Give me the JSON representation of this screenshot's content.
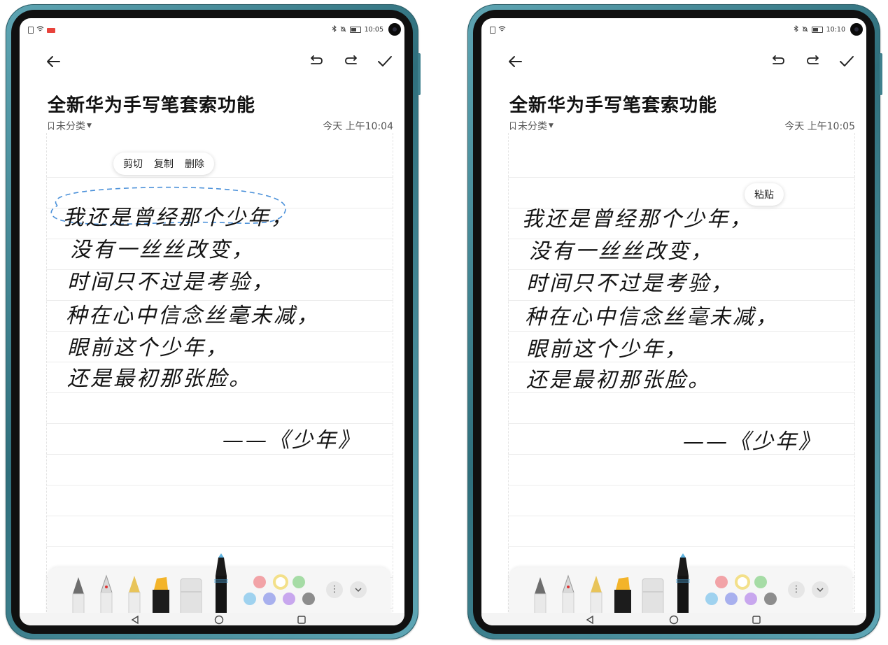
{
  "screens": [
    {
      "status": {
        "time": "10:05"
      },
      "note": {
        "title": "全新华为手写笔套索功能",
        "category": "未分类",
        "timestamp": "今天 上午10:04"
      },
      "popup": {
        "items": [
          "剪切",
          "复制",
          "删除"
        ]
      },
      "handwriting": {
        "lines": [
          "我还是曾经那个少年，",
          "没有一丝丝改变，",
          "时间只不过是考验，",
          "种在心中信念丝毫未减，",
          "眼前这个少年，",
          "还是最初那张脸。"
        ],
        "signature": "——《少年》"
      }
    },
    {
      "status": {
        "time": "10:10"
      },
      "note": {
        "title": "全新华为手写笔套索功能",
        "category": "未分类",
        "timestamp": "今天 上午10:05"
      },
      "popup": {
        "items": [
          "粘贴"
        ]
      },
      "handwriting": {
        "lines": [
          "我还是曾经那个少年，",
          "没有一丝丝改变，",
          "时间只不过是考验，",
          "种在心中信念丝毫未减，",
          "眼前这个少年，",
          "还是最初那张脸。"
        ],
        "signature": "——《少年》"
      }
    }
  ],
  "icons": {
    "back": "arrow-left-icon",
    "undo": "undo-icon",
    "redo": "redo-icon",
    "done": "check-icon",
    "more": "more-vertical-icon",
    "collapse": "chevron-down-icon"
  },
  "pen_colors": [
    "#f2a3a7",
    "#f3e08a",
    "#a6dca6",
    "#9fd2ef",
    "#a8b0ee",
    "#c8a7ee",
    "#8d8d8d"
  ]
}
